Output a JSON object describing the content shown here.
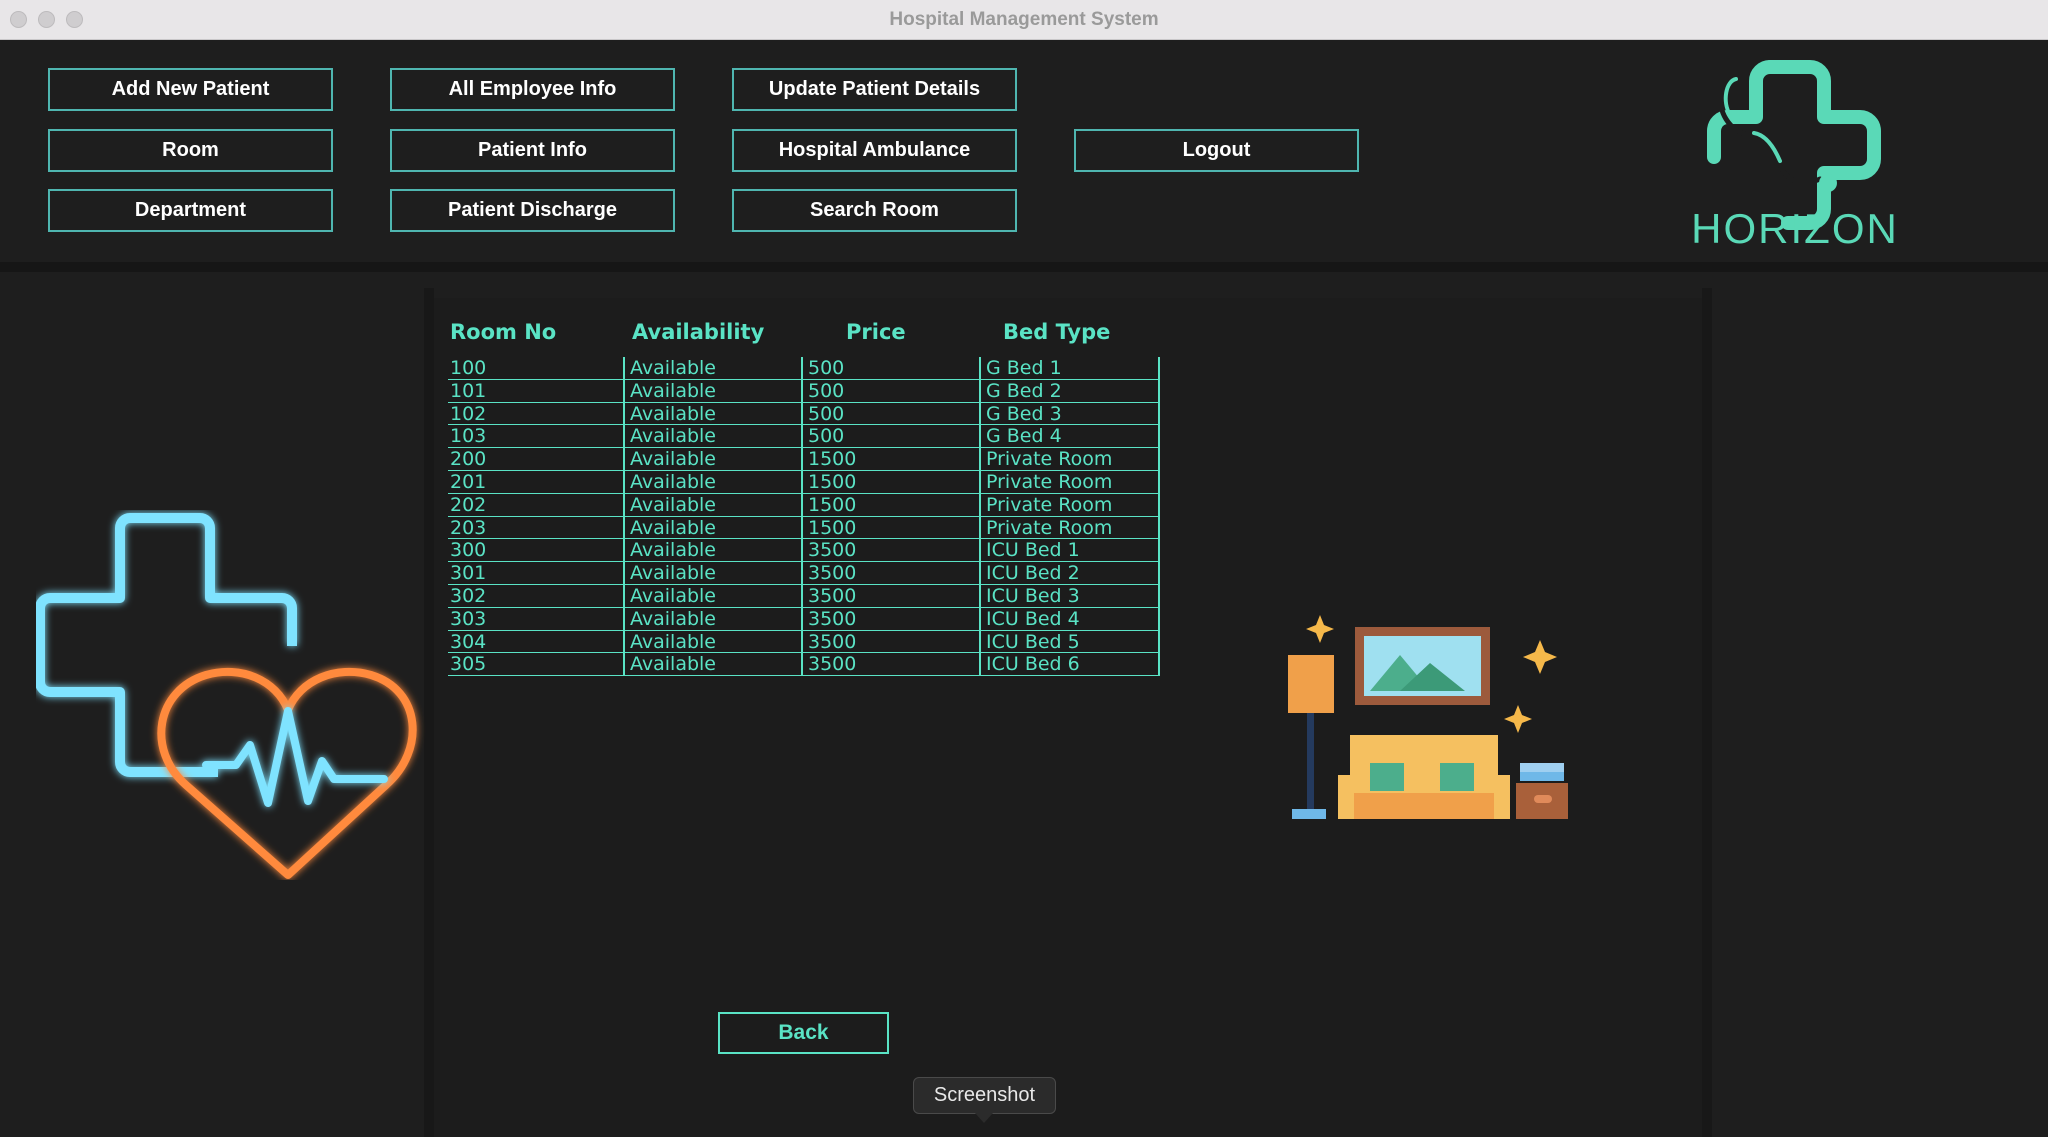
{
  "window": {
    "title": "Hospital Management System"
  },
  "menu": {
    "add_new_patient": "Add New Patient",
    "all_employee_info": "All Employee Info",
    "update_patient_details": "Update Patient Details",
    "room": "Room",
    "patient_info": "Patient Info",
    "hospital_ambulance": "Hospital Ambulance",
    "logout": "Logout",
    "department": "Department",
    "patient_discharge": "Patient Discharge",
    "search_room": "Search Room"
  },
  "logo": {
    "text": "HORIZON",
    "icon": "stethoscope-cross-icon"
  },
  "table": {
    "headers": [
      "Room No",
      "Availability",
      "Price",
      "Bed Type"
    ],
    "rows": [
      [
        "100",
        "Available",
        "500",
        "G Bed 1"
      ],
      [
        "101",
        "Available",
        "500",
        "G Bed 2"
      ],
      [
        "102",
        "Available",
        "500",
        "G Bed 3"
      ],
      [
        "103",
        "Available",
        "500",
        "G Bed 4"
      ],
      [
        "200",
        "Available",
        "1500",
        "Private Room"
      ],
      [
        "201",
        "Available",
        "1500",
        "Private Room"
      ],
      [
        "202",
        "Available",
        "1500",
        "Private Room"
      ],
      [
        "203",
        "Available",
        "1500",
        "Private Room"
      ],
      [
        "300",
        "Available",
        "3500",
        "ICU Bed 1"
      ],
      [
        "301",
        "Available",
        "3500",
        "ICU Bed 2"
      ],
      [
        "302",
        "Available",
        "3500",
        "ICU Bed 3"
      ],
      [
        "303",
        "Available",
        "3500",
        "ICU Bed 4"
      ],
      [
        "304",
        "Available",
        "3500",
        "ICU Bed 5"
      ],
      [
        "305",
        "Available",
        "3500",
        "ICU Bed 6"
      ]
    ]
  },
  "back_label": "Back",
  "tooltip": "Screenshot",
  "illustrations": {
    "left": "neon-cross-heartbeat-icon",
    "right": "room-sofa-lamp-icon"
  },
  "colors": {
    "accent": "#5ae3c5",
    "button_border": "#4fb6b0",
    "background": "#1e1e1e"
  }
}
